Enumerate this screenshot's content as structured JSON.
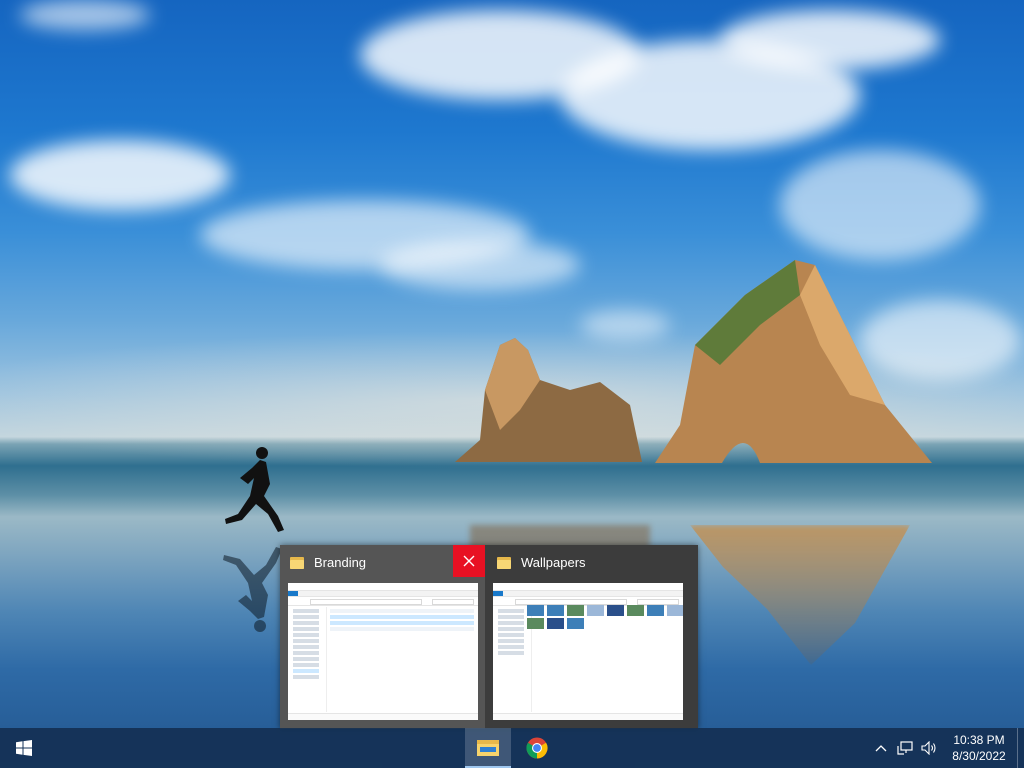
{
  "desktop": {
    "wallpaper": "beach-with-rock-arches-and-runner"
  },
  "thumbnails": [
    {
      "title": "Branding",
      "icon": "folder-icon",
      "hovered": true
    },
    {
      "title": "Wallpapers",
      "icon": "folder-icon",
      "hovered": false
    }
  ],
  "close_label": "Close",
  "taskbar": {
    "start_icon": "windows-logo-icon",
    "apps": [
      {
        "name": "File Explorer",
        "icon": "file-explorer-icon",
        "active": true
      },
      {
        "name": "Google Chrome",
        "icon": "chrome-icon",
        "active": false
      }
    ],
    "tray": {
      "icons": [
        "chevron-up-icon",
        "network-icon",
        "volume-icon"
      ],
      "time": "10:38 PM",
      "date": "8/30/2022"
    }
  },
  "colors": {
    "accent": "#e81123",
    "taskbar": "#143052",
    "folder": "#f8d775"
  }
}
